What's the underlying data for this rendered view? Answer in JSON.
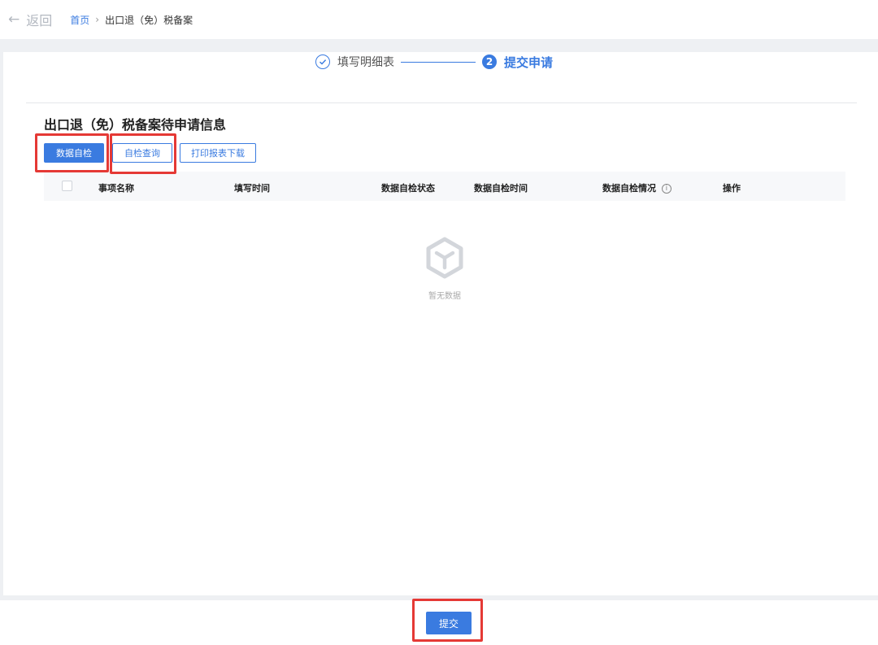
{
  "topbar": {
    "back_label": "返回",
    "back_icon": "arrow-left-icon"
  },
  "breadcrumb": {
    "home": "首页",
    "current": "出口退（免）税备案",
    "separator_icon": "chevron-right-icon"
  },
  "steps": [
    {
      "label": "填写明细表",
      "status": "done",
      "icon": "check-circle-icon"
    },
    {
      "label": "提交申请",
      "status": "active",
      "number": "2"
    }
  ],
  "section": {
    "title": "出口退（免）税备案待申请信息"
  },
  "toolbar": {
    "data_check": "数据自检",
    "check_query": "自检查询",
    "print_download": "打印报表下载"
  },
  "table": {
    "columns": [
      "事项名称",
      "填写时间",
      "数据自检状态",
      "数据自检时间",
      "数据自检情况",
      "操作"
    ],
    "info_icon": "info-circle-icon",
    "empty_icon": "empty-box-icon",
    "empty_text": "暂无数据"
  },
  "footer": {
    "submit": "提交"
  },
  "colors": {
    "primary": "#3a7be0",
    "highlight": "#e53935"
  }
}
